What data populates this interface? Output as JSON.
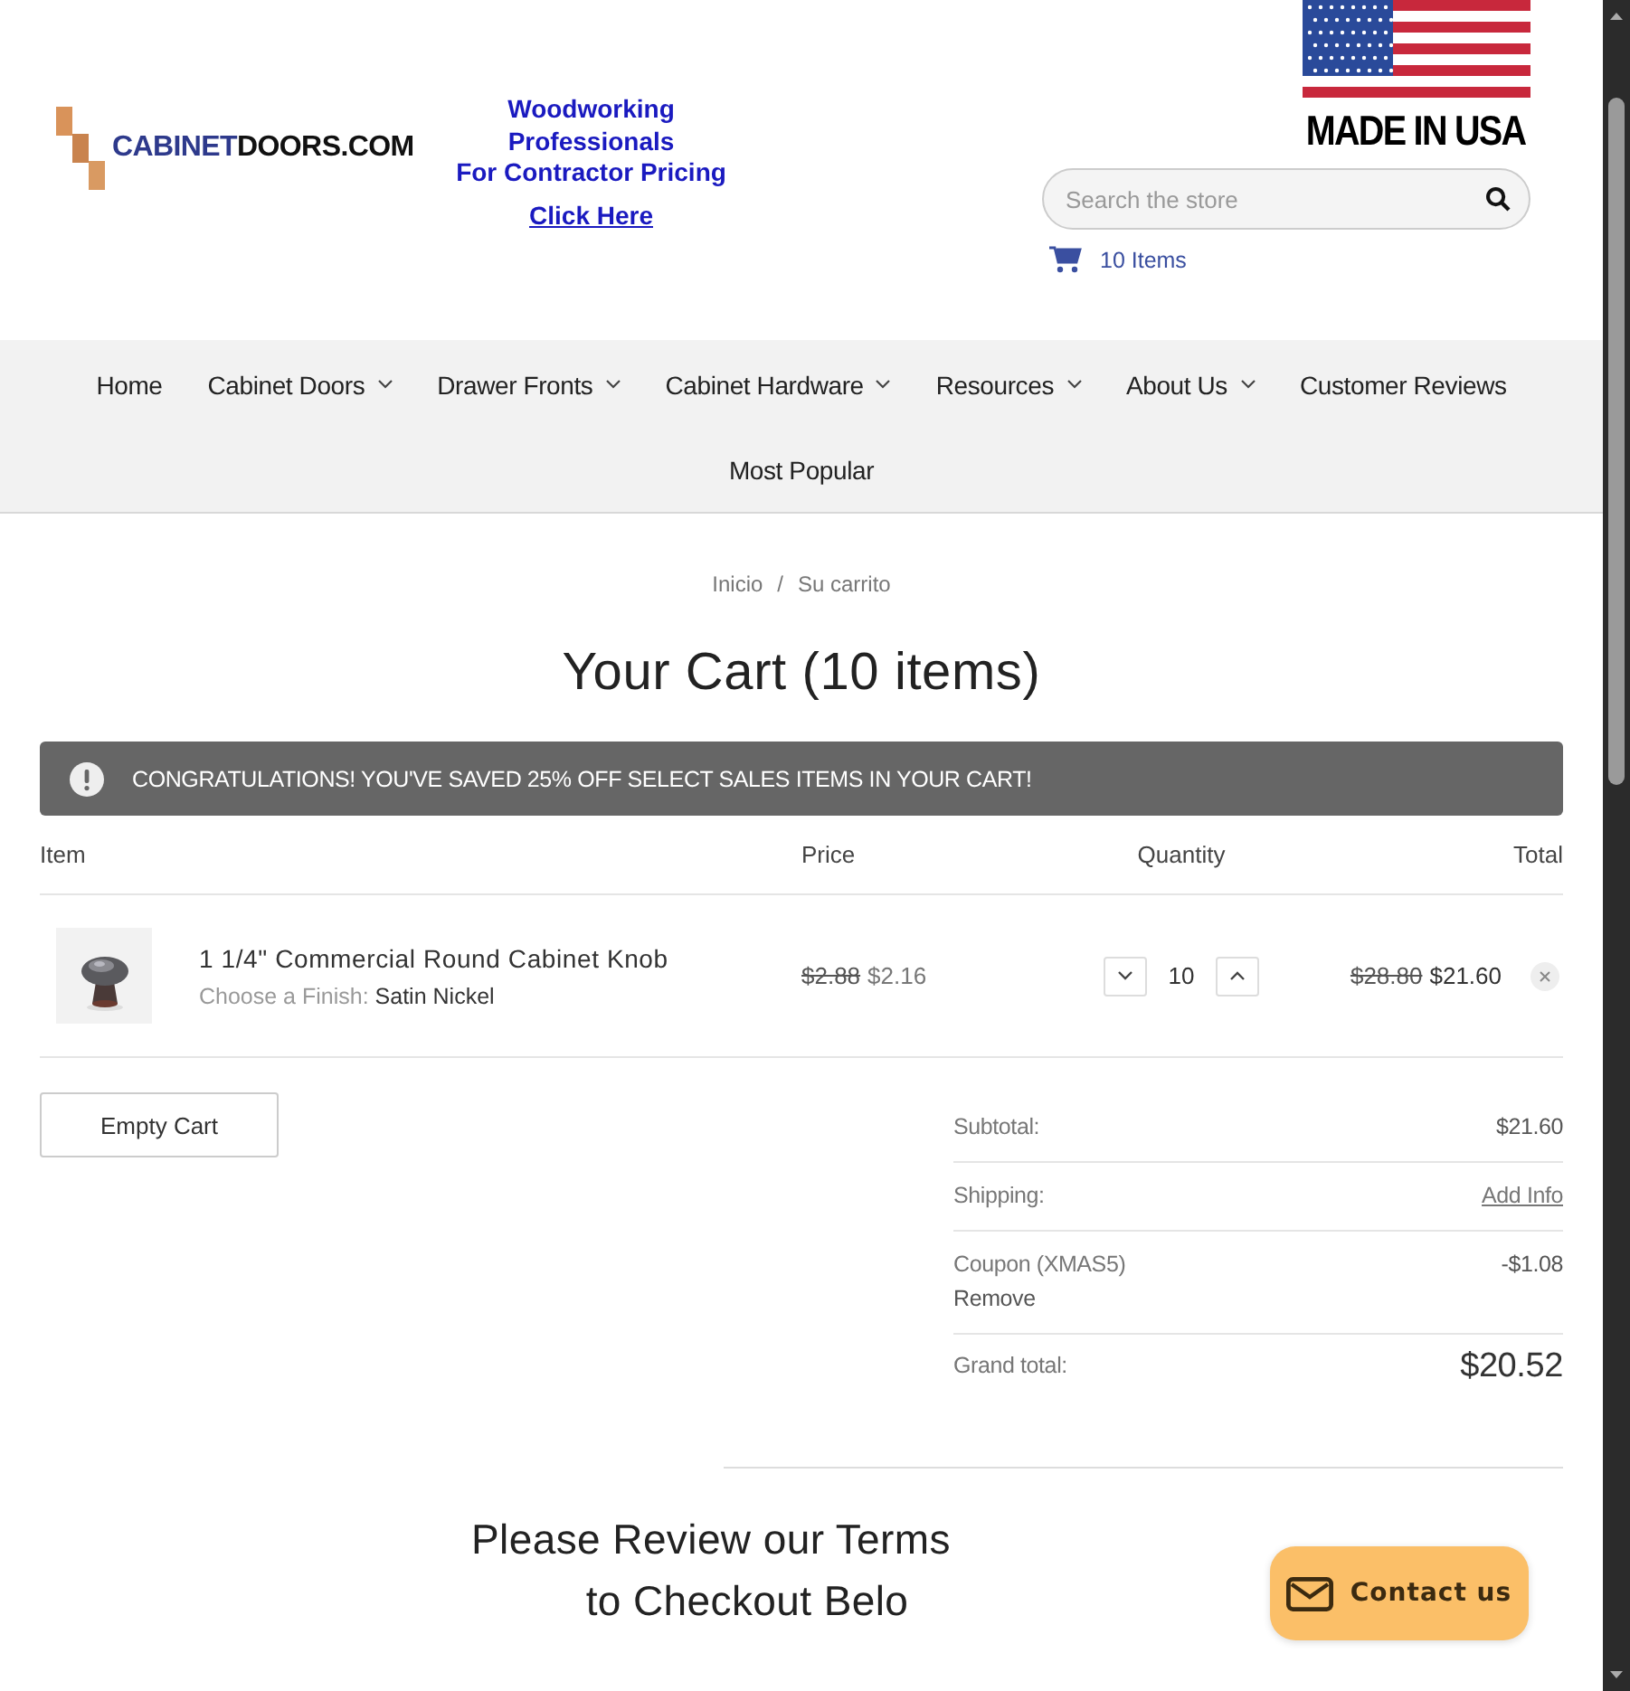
{
  "header": {
    "logo": {
      "accent": "CABINET",
      "rest": "DOORS.COM"
    },
    "promo": {
      "lines": [
        "Woodworking",
        "Professionals",
        "For Contractor Pricing"
      ],
      "link": "Click Here"
    },
    "badge": "MADE IN USA",
    "search": {
      "placeholder": "Search the store"
    },
    "cart_link": "10 Items"
  },
  "nav": [
    {
      "label": "Home",
      "has_menu": false
    },
    {
      "label": "Cabinet Doors",
      "has_menu": true
    },
    {
      "label": "Drawer Fronts",
      "has_menu": true
    },
    {
      "label": "Cabinet Hardware",
      "has_menu": true
    },
    {
      "label": "Resources",
      "has_menu": true
    },
    {
      "label": "About Us",
      "has_menu": true
    },
    {
      "label": "Customer Reviews",
      "has_menu": false
    },
    {
      "label": "Most Popular",
      "has_menu": false
    }
  ],
  "breadcrumbs": {
    "items": [
      "Inicio",
      "Su carrito"
    ],
    "separator": "/"
  },
  "title": "Your Cart (10 items)",
  "alert": "CONGRATULATIONS! YOU'VE SAVED 25% OFF SELECT SALES ITEMS IN YOUR CART!",
  "table": {
    "columns": [
      "Item",
      "Price",
      "Quantity",
      "Total"
    ],
    "rows": [
      {
        "name": "1 1/4\" Commercial Round Cabinet Knob",
        "option_label": "Choose a Finish:",
        "option_value": "Satin Nickel",
        "price_was": "$2.88",
        "price": "$2.16",
        "quantity": "10",
        "total_was": "$28.80",
        "total": "$21.60"
      }
    ]
  },
  "empty_cart": "Empty Cart",
  "totals": [
    {
      "kind": "amount",
      "label": "Subtotal:",
      "value": "$21.60"
    },
    {
      "kind": "link",
      "label": "Shipping:",
      "value": "Add Info"
    },
    {
      "kind": "coupon",
      "label": "Coupon (XMAS5)",
      "action": "Remove",
      "value": "-$1.08"
    },
    {
      "kind": "grand",
      "label": "Grand total:",
      "value": "$20.52"
    }
  ],
  "terms_heading": [
    "Please Review our Terms",
    "to Checkout Belo"
  ],
  "contact_button": "Contact us"
}
